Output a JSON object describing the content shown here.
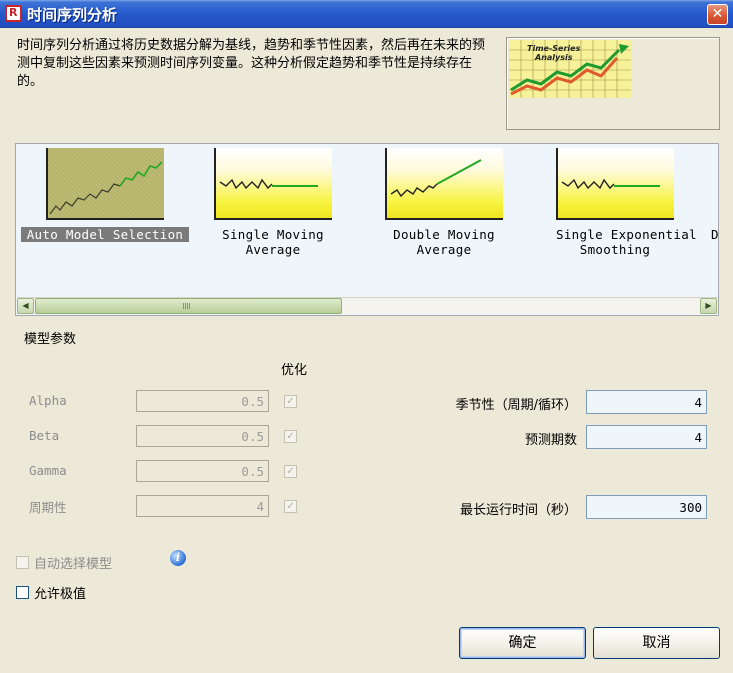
{
  "window": {
    "title": "时间序列分析",
    "close_label": "✕"
  },
  "description": "时间序列分析通过将历史数据分解为基线，趋势和季节性因素，然后再在未来的预测中复制这些因素来预测时间序列变量。这种分析假定趋势和季节性是持续存在的。",
  "hero_image": {
    "line1": "Time-Series",
    "line2": "Analysis"
  },
  "models": [
    {
      "label": "Auto Model Selection",
      "icon": "auto-trend-chart",
      "selected": true
    },
    {
      "label": "Single Moving\nAverage",
      "icon": "flat-forecast-chart",
      "selected": false
    },
    {
      "label": "Double Moving\nAverage",
      "icon": "rising-forecast-chart",
      "selected": false
    },
    {
      "label": "Single Exponential\nSmoothing",
      "icon": "flat-forecast-chart",
      "selected": false
    },
    {
      "label": "D",
      "icon": "partial",
      "selected": false
    }
  ],
  "scrollbar": {
    "left_arrow": "◀",
    "right_arrow": "▶"
  },
  "params": {
    "section_title": "模型参数",
    "optimize_header": "优化",
    "rows": [
      {
        "label": "Alpha",
        "value": "0.5",
        "optimize": true
      },
      {
        "label": "Beta",
        "value": "0.5",
        "optimize": true
      },
      {
        "label": "Gamma",
        "value": "0.5",
        "optimize": true
      },
      {
        "label": "周期性",
        "value": "4",
        "optimize": true
      }
    ],
    "seasonality_label": "季节性（周期/循环）",
    "seasonality_value": "4",
    "forecast_label": "预测期数",
    "forecast_value": "4",
    "maxtime_label": "最长运行时间（秒）",
    "maxtime_value": "300"
  },
  "options": {
    "auto_select_label": "自动选择模型",
    "auto_select_checked": false,
    "allow_extreme_label": "允许极值",
    "allow_extreme_checked": false
  },
  "buttons": {
    "ok": "确定",
    "cancel": "取消"
  },
  "colors": {
    "title_bar": "#2454c6",
    "dialog_bg": "#ECE9D8",
    "gallery_bg": "#EFF6FB",
    "forecast_line": "#22a822",
    "thumb_yellow": "#f7f33a"
  }
}
